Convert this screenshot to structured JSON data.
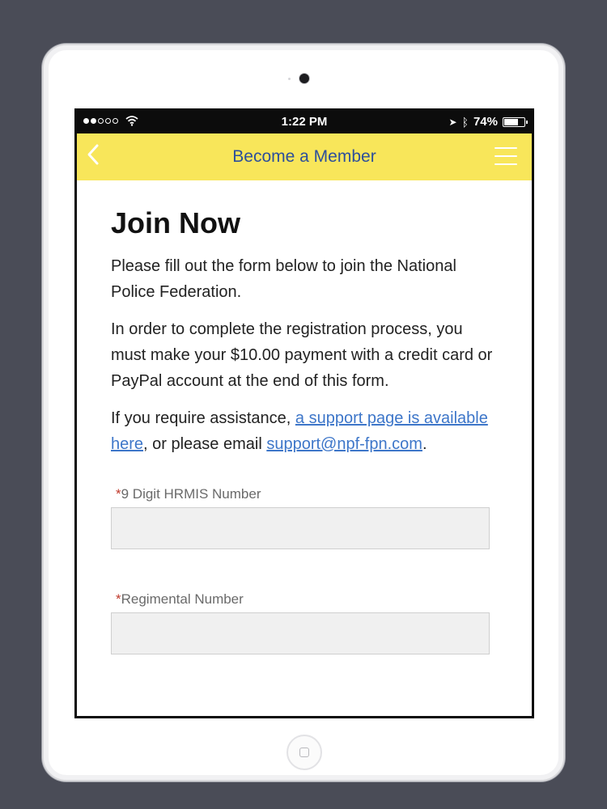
{
  "status_bar": {
    "time": "1:22 PM",
    "battery": "74%",
    "battery_level": 0.74,
    "signal_bars_filled": 2,
    "signal_bars_total": 5
  },
  "nav": {
    "title": "Become a Member",
    "back_icon": "chevron-left-icon",
    "menu_icon": "hamburger-icon"
  },
  "content": {
    "title": "Join Now",
    "intro": "Please fill out the form below to join the National Police Federation.",
    "payment_note": "In order to complete the registration process, you must make your $10.00 payment with a credit card or PayPal account at the end of this form.",
    "assist_prefix": "If you require assistance, ",
    "support_link": "a support page is available here",
    "assist_middle": ", or please email ",
    "email_link": "support@npf-fpn.com",
    "assist_suffix": "."
  },
  "form": {
    "fields": [
      {
        "required_mark": "*",
        "label": "9 Digit HRMIS Number",
        "value": ""
      },
      {
        "required_mark": "*",
        "label": "Regimental Number",
        "value": ""
      }
    ]
  },
  "colors": {
    "nav_background": "#f8e65a",
    "nav_title": "#2d4f9b",
    "link": "#3d76c9",
    "required": "#c0392b"
  }
}
